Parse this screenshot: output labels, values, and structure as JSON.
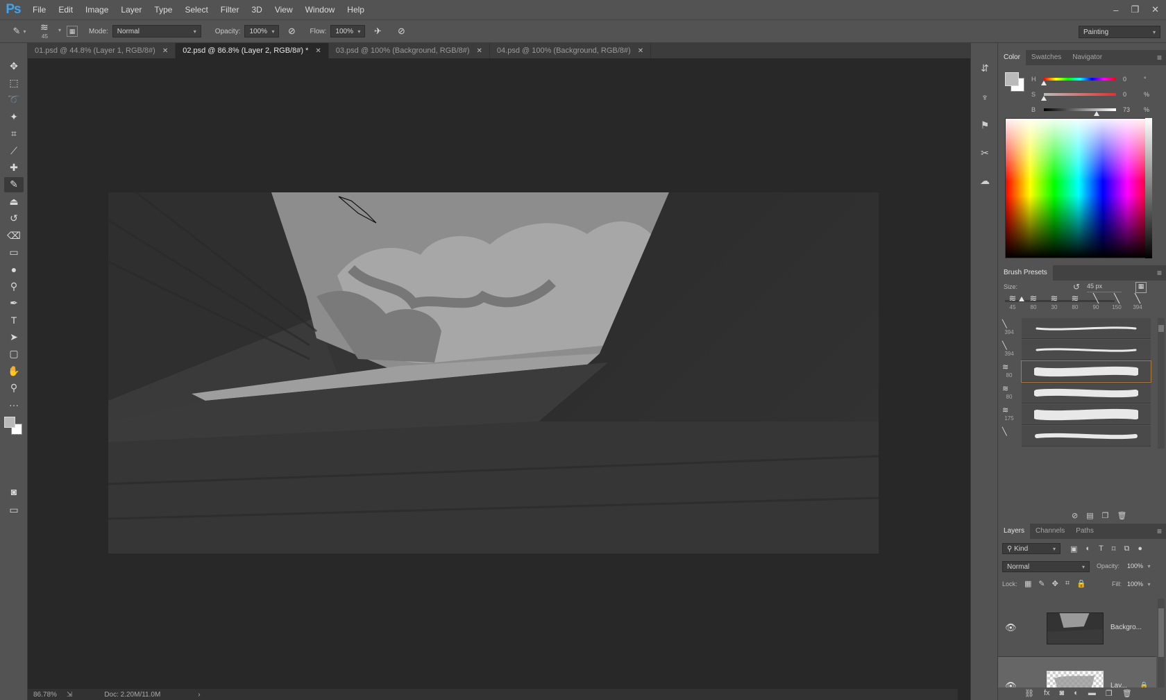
{
  "app": {
    "logo": "Ps"
  },
  "menu": [
    "File",
    "Edit",
    "Image",
    "Layer",
    "Type",
    "Select",
    "Filter",
    "3D",
    "View",
    "Window",
    "Help"
  ],
  "window_controls": [
    "–",
    "❐",
    "✕"
  ],
  "options": {
    "brush_size": "45",
    "mode_label": "Mode:",
    "mode_value": "Normal",
    "opacity_label": "Opacity:",
    "opacity_value": "100%",
    "flow_label": "Flow:",
    "flow_value": "100%",
    "workspace": "Painting"
  },
  "tabs": [
    {
      "label": "01.psd @ 44.8% (Layer 1, RGB/8#)",
      "active": false
    },
    {
      "label": "02.psd @ 86.8% (Layer 2, RGB/8#) *",
      "active": true
    },
    {
      "label": "03.psd @ 100% (Background, RGB/8#)",
      "active": false
    },
    {
      "label": "04.psd @ 100% (Background, RGB/8#)",
      "active": false
    }
  ],
  "tools": [
    {
      "name": "move-tool",
      "glyph": "✥"
    },
    {
      "name": "marquee-tool",
      "glyph": "⬚"
    },
    {
      "name": "lasso-tool",
      "glyph": "➰"
    },
    {
      "name": "magic-wand-tool",
      "glyph": "✦"
    },
    {
      "name": "crop-tool",
      "glyph": "⌗"
    },
    {
      "name": "eyedropper-tool",
      "glyph": "⟋"
    },
    {
      "name": "healing-brush-tool",
      "glyph": "✚"
    },
    {
      "name": "brush-tool",
      "glyph": "✎",
      "active": true
    },
    {
      "name": "clone-stamp-tool",
      "glyph": "⏏"
    },
    {
      "name": "history-brush-tool",
      "glyph": "↺"
    },
    {
      "name": "eraser-tool",
      "glyph": "⌫"
    },
    {
      "name": "gradient-tool",
      "glyph": "▭"
    },
    {
      "name": "blur-tool",
      "glyph": "●"
    },
    {
      "name": "dodge-tool",
      "glyph": "⚲"
    },
    {
      "name": "pen-tool",
      "glyph": "✒"
    },
    {
      "name": "type-tool",
      "glyph": "T"
    },
    {
      "name": "path-selection-tool",
      "glyph": "➤"
    },
    {
      "name": "rectangle-tool",
      "glyph": "▢"
    },
    {
      "name": "hand-tool",
      "glyph": "✋"
    },
    {
      "name": "zoom-tool",
      "glyph": "⚲"
    },
    {
      "name": "more-tools",
      "glyph": "···"
    }
  ],
  "status": {
    "zoom": "86.78%",
    "doc": "Doc: 2.20M/11.0M"
  },
  "color_panel": {
    "tabs": [
      "Color",
      "Swatches",
      "Navigator"
    ],
    "sliders": [
      {
        "label": "H",
        "value": "0",
        "unit": "°",
        "level": 0.0
      },
      {
        "label": "S",
        "value": "0",
        "unit": "%",
        "level": 0.0
      },
      {
        "label": "B",
        "value": "73",
        "unit": "%",
        "level": 0.73
      }
    ]
  },
  "brush_panel": {
    "title": "Brush Presets",
    "size_label": "Size:",
    "size_value": "45 px",
    "size_level": 0.15,
    "top_presets": [
      "45",
      "80",
      "30",
      "80",
      "90",
      "150",
      "394"
    ],
    "list": [
      {
        "size": "394",
        "selected": false
      },
      {
        "size": "394",
        "selected": false
      },
      {
        "size": "80",
        "selected": true
      },
      {
        "size": "80",
        "selected": false
      },
      {
        "size": "175",
        "selected": false
      },
      {
        "size": "",
        "selected": false
      }
    ]
  },
  "layers_panel": {
    "tabs": [
      "Layers",
      "Channels",
      "Paths"
    ],
    "kind": "Kind",
    "blend_mode": "Normal",
    "opacity_label": "Opacity:",
    "opacity_value": "100%",
    "lock_label": "Lock:",
    "fill_label": "Fill:",
    "fill_value": "100%",
    "layers": [
      {
        "name": "Backgro..."
      },
      {
        "name": "Lay..."
      }
    ]
  }
}
